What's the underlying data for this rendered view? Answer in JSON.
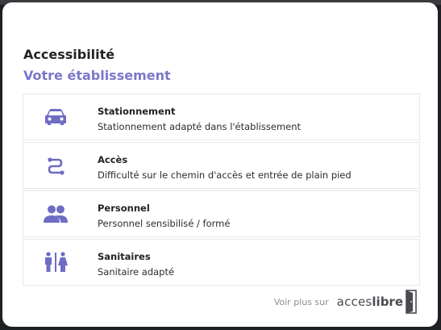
{
  "modal": {
    "title": "Accessibilité",
    "subtitle": "Votre établissement",
    "accent_color": "#6f6cc4"
  },
  "items": [
    {
      "icon": "car-icon",
      "label": "Stationnement",
      "description": "Stationnement adapté dans l'établissement"
    },
    {
      "icon": "path-icon",
      "label": "Accès",
      "description": "Difficulté sur le chemin d'accès et entrée de plain pied"
    },
    {
      "icon": "people-icon",
      "label": "Personnel",
      "description": "Personnel sensibilisé / formé"
    },
    {
      "icon": "restroom-icon",
      "label": "Sanitaires",
      "description": "Sanitaire adapté"
    }
  ],
  "footer": {
    "see_more": "Voir plus sur",
    "brand_part1": "acces",
    "brand_part2": "libre"
  }
}
